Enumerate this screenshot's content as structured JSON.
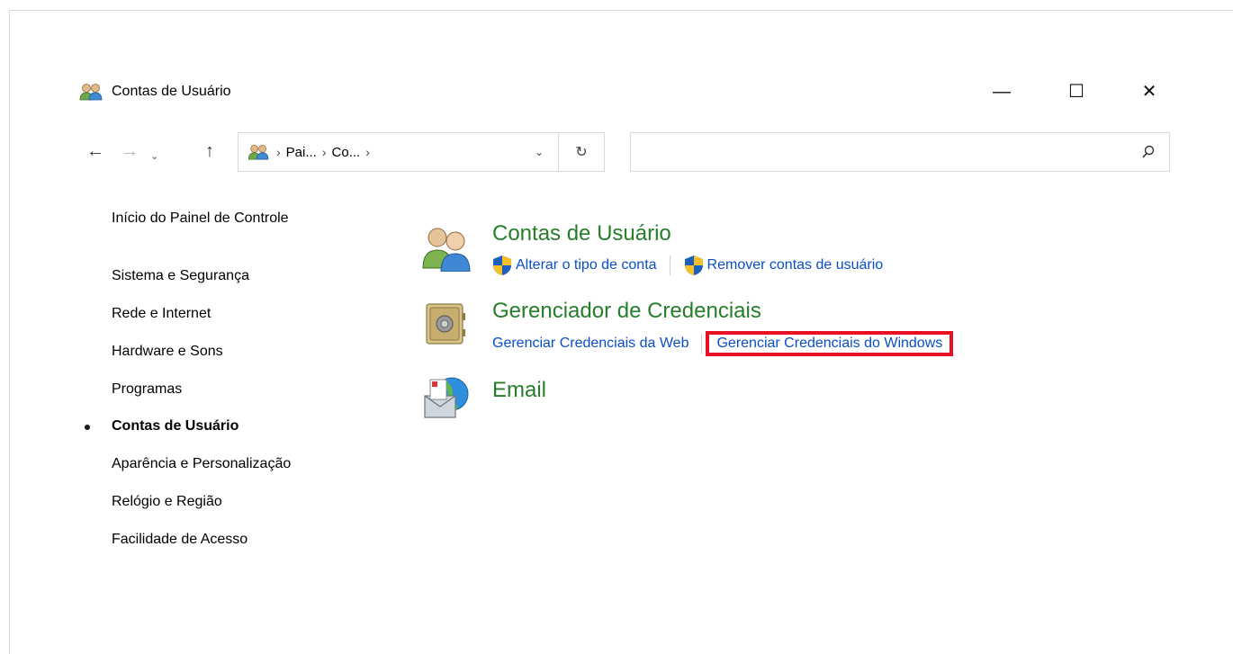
{
  "window": {
    "title": "Contas de Usuário",
    "minimize_glyph": "—",
    "maximize_glyph": "☐",
    "close_glyph": "✕"
  },
  "nav": {
    "back_glyph": "←",
    "forward_glyph": "→",
    "recent_glyph": "⌄",
    "up_glyph": "↑"
  },
  "address": {
    "crumbs": [
      "Pai...",
      "Co..."
    ],
    "separator": "›",
    "dropdown_glyph": "⌄",
    "refresh_glyph": "↻"
  },
  "search": {
    "placeholder": "",
    "value": ""
  },
  "sidebar": {
    "items": [
      {
        "label": "Início do Painel de Controle"
      },
      {
        "label": "Sistema e Segurança"
      },
      {
        "label": "Rede e Internet"
      },
      {
        "label": "Hardware e Sons"
      },
      {
        "label": "Programas"
      },
      {
        "label": "Contas de Usuário",
        "current": true
      },
      {
        "label": "Aparência e Personalização"
      },
      {
        "label": "Relógio e Região"
      },
      {
        "label": "Facilidade de Acesso"
      }
    ]
  },
  "categories": [
    {
      "title": "Contas de Usuário",
      "icon": "users-icon",
      "links": [
        {
          "label": "Alterar o tipo de conta",
          "shield": true
        },
        {
          "label": "Remover contas de usuário",
          "shield": true
        }
      ]
    },
    {
      "title": "Gerenciador de Credenciais",
      "icon": "vault-icon",
      "links": [
        {
          "label": "Gerenciar Credenciais da Web"
        },
        {
          "label": "Gerenciar Credenciais do Windows",
          "highlighted": true
        }
      ]
    },
    {
      "title": "Email",
      "icon": "mail-icon",
      "links": []
    }
  ],
  "colors": {
    "category_title": "#267e2b",
    "link": "#0a4ec7",
    "highlight_box": "#e81123"
  }
}
